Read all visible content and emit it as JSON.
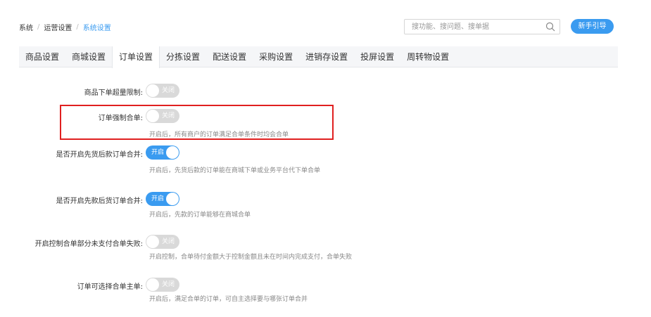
{
  "breadcrumb": [
    "系统",
    "运营设置",
    "系统设置"
  ],
  "search": {
    "placeholder": "搜功能、搜问题、搜单据"
  },
  "header": {
    "guide_label": "新手引导"
  },
  "tabs": [
    {
      "label": "商品设置",
      "active": false
    },
    {
      "label": "商城设置",
      "active": false
    },
    {
      "label": "订单设置",
      "active": true
    },
    {
      "label": "分拣设置",
      "active": false
    },
    {
      "label": "配送设置",
      "active": false
    },
    {
      "label": "采购设置",
      "active": false
    },
    {
      "label": "进销存设置",
      "active": false
    },
    {
      "label": "投屏设置",
      "active": false
    },
    {
      "label": "周转物设置",
      "active": false
    }
  ],
  "settings": [
    {
      "label": "商品下单超量限制:",
      "toggle": "关闭",
      "on": false,
      "desc": ""
    },
    {
      "label": "订单强制合单:",
      "toggle": "关闭",
      "on": false,
      "desc": "开启后，所有商户的订单满足合单条件时均会合单",
      "highlighted": true
    },
    {
      "label": "是否开启先货后款订单合并:",
      "toggle": "开启",
      "on": true,
      "desc": "开启后，先货后款的订单能在商城下单或业务平台代下单合单"
    },
    {
      "label": "是否开启先款后货订单合并:",
      "toggle": "开启",
      "on": true,
      "desc": "开启后，先款的订单能够在商城合单"
    },
    {
      "label": "开启控制合单部分未支付合单失败:",
      "toggle": "关闭",
      "on": false,
      "desc": "开启控制，合单待付金额大于控制金额且未在时间内完成支付，合单失败"
    },
    {
      "label": "订单可选择合单主单:",
      "toggle": "关闭",
      "on": false,
      "desc": "开启后，满足合单的订单，可自主选择要与哪张订单合并"
    }
  ],
  "colors": {
    "accent": "#3a9bf0",
    "toggle_off": "#d9d9d9",
    "highlight": "#e02020"
  }
}
